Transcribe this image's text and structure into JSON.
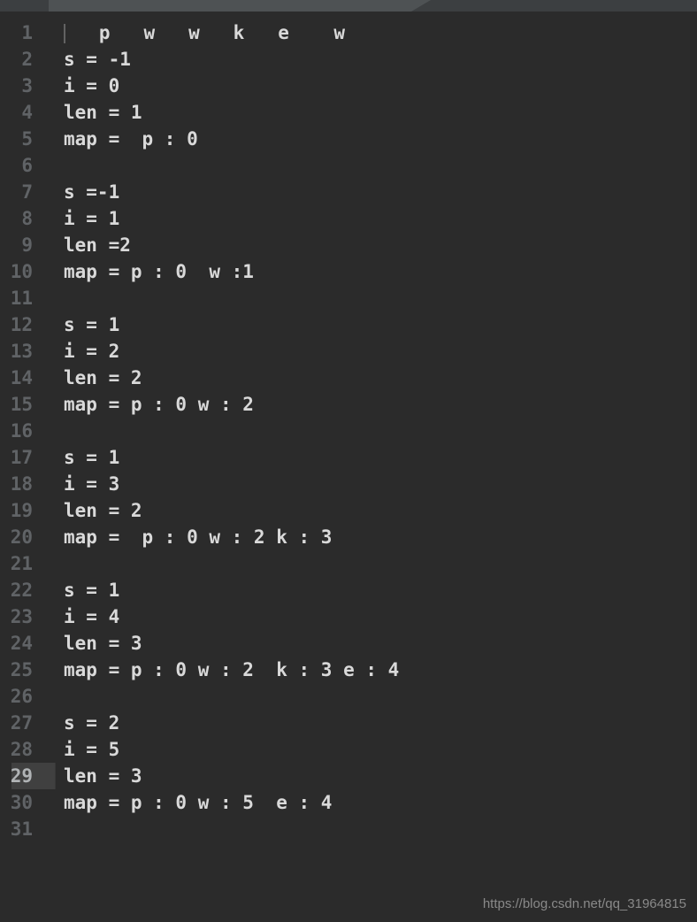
{
  "lines": [
    {
      "n": "1",
      "t": "   p   w   w   k   e    w"
    },
    {
      "n": "2",
      "t": "s = -1"
    },
    {
      "n": "3",
      "t": "i = 0"
    },
    {
      "n": "4",
      "t": "len = 1"
    },
    {
      "n": "5",
      "t": "map =  p : 0"
    },
    {
      "n": "6",
      "t": ""
    },
    {
      "n": "7",
      "t": "s =-1"
    },
    {
      "n": "8",
      "t": "i = 1"
    },
    {
      "n": "9",
      "t": "len =2"
    },
    {
      "n": "10",
      "t": "map = p : 0  w :1"
    },
    {
      "n": "11",
      "t": ""
    },
    {
      "n": "12",
      "t": "s = 1"
    },
    {
      "n": "13",
      "t": "i = 2"
    },
    {
      "n": "14",
      "t": "len = 2"
    },
    {
      "n": "15",
      "t": "map = p : 0 w : 2"
    },
    {
      "n": "16",
      "t": ""
    },
    {
      "n": "17",
      "t": "s = 1"
    },
    {
      "n": "18",
      "t": "i = 3"
    },
    {
      "n": "19",
      "t": "len = 2"
    },
    {
      "n": "20",
      "t": "map =  p : 0 w : 2 k : 3"
    },
    {
      "n": "21",
      "t": ""
    },
    {
      "n": "22",
      "t": "s = 1"
    },
    {
      "n": "23",
      "t": "i = 4"
    },
    {
      "n": "24",
      "t": "len = 3"
    },
    {
      "n": "25",
      "t": "map = p : 0 w : 2  k : 3 e : 4"
    },
    {
      "n": "26",
      "t": ""
    },
    {
      "n": "27",
      "t": "s = 2"
    },
    {
      "n": "28",
      "t": "i = 5"
    },
    {
      "n": "29",
      "t": "len = 3",
      "active": true
    },
    {
      "n": "30",
      "t": "map = p : 0 w : 5  e : 4"
    },
    {
      "n": "31",
      "t": ""
    }
  ],
  "watermark": "https://blog.csdn.net/qq_31964815"
}
